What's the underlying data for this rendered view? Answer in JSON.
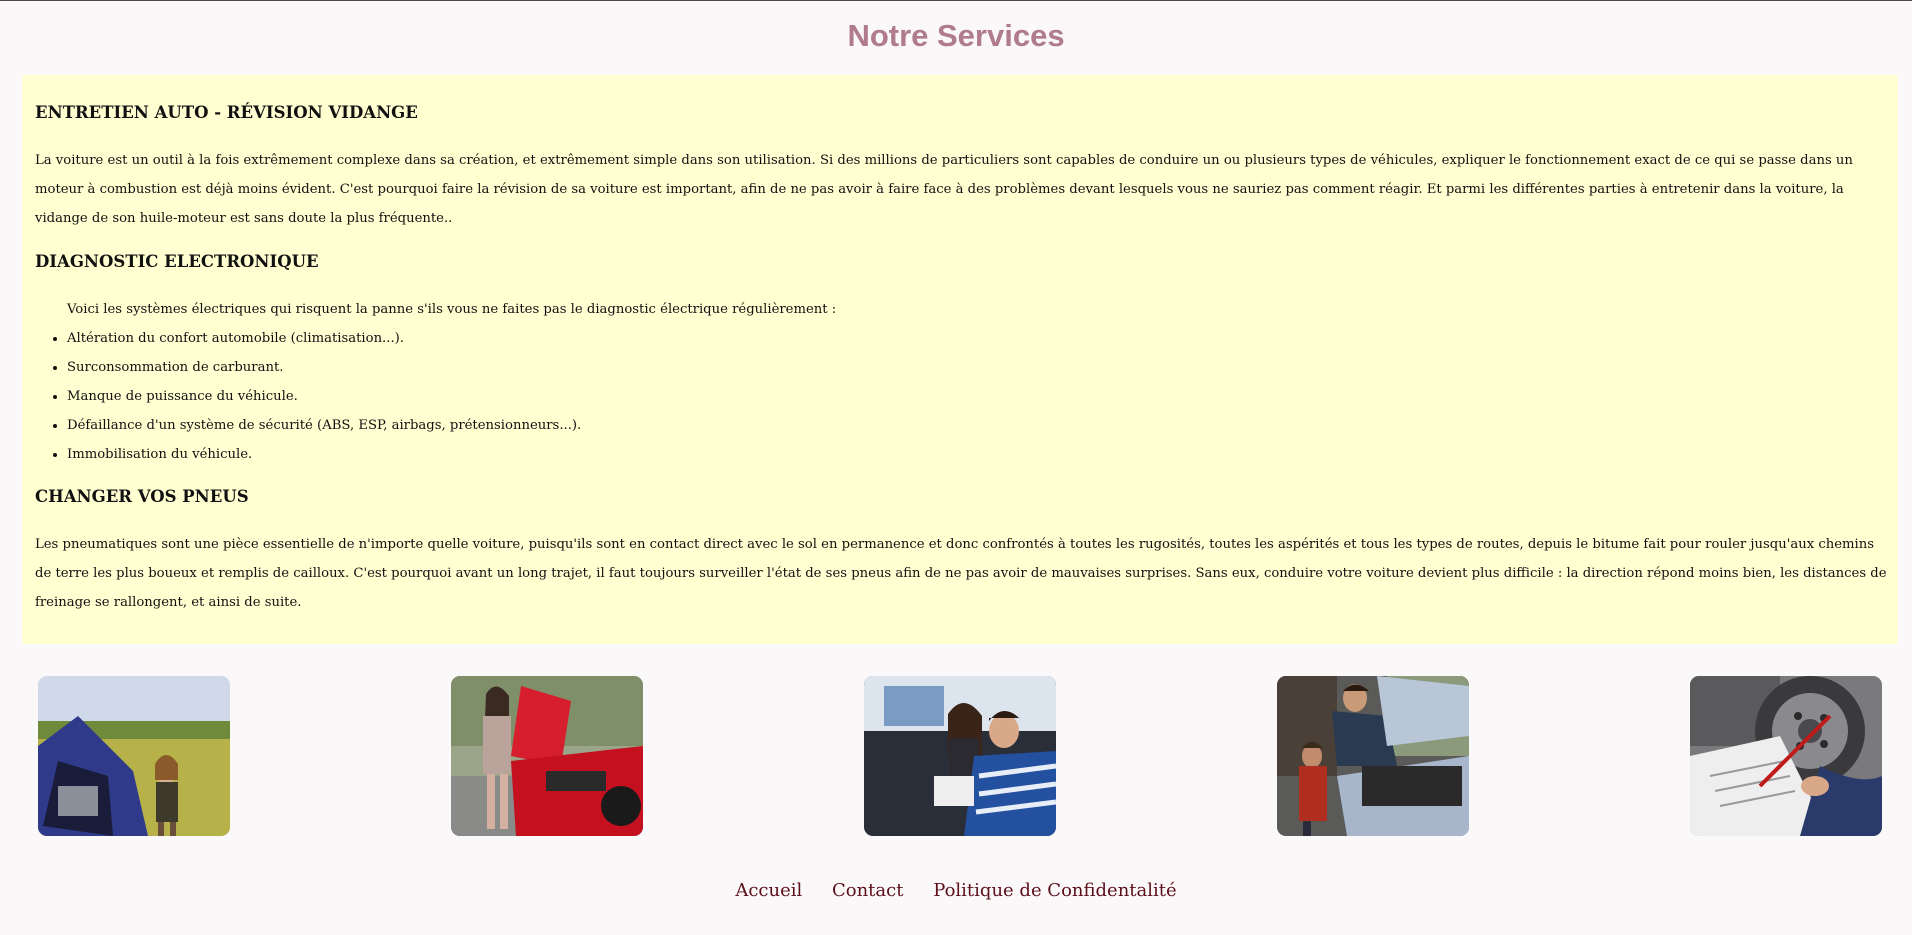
{
  "page": {
    "title": "Notre Services"
  },
  "services": [
    {
      "heading": "ENTRETIEN AUTO - RÉVISION VIDANGE",
      "text": "La voiture est un outil à la fois extrêmement complexe dans sa création, et extrêmement simple dans son utilisation. Si des millions de particuliers sont capables de conduire un ou plusieurs types de véhicules, expliquer le fonctionnement exact de ce qui se passe dans un moteur à combustion est déjà moins évident. C'est pourquoi faire la révision de sa voiture est important, afin de ne pas avoir à faire face à des problèmes devant lesquels vous ne sauriez pas comment réagir. Et parmi les différentes parties à entretenir dans la voiture, la vidange de son huile-moteur est sans doute la plus fréquente.."
    },
    {
      "heading": "DIAGNOSTIC ELECTRONIQUE",
      "intro": "Voici les systèmes électriques qui risquent la panne s'ils vous ne faites pas le diagnostic électrique régulièrement :",
      "items": [
        "Altération du confort automobile (climatisation...).",
        "Surconsommation de carburant.",
        "Manque de puissance du véhicule.",
        "Défaillance d'un système de sécurité (ABS, ESP, airbags, prétensionneurs...).",
        "Immobilisation du véhicule."
      ]
    },
    {
      "heading": "CHANGER VOS PNEUS",
      "text": "Les pneumatiques sont une pièce essentielle de n'importe quelle voiture, puisqu'ils sont en contact direct avec le sol en permanence et donc confrontés à toutes les rugosités, toutes les aspérités et tous les types de routes, depuis le bitume fait pour rouler jusqu'aux chemins de terre les plus boueux et remplis de cailloux. C'est pourquoi avant un long trajet, il faut toujours surveiller l'état de ses pneus afin de ne pas avoir de mauvaises surprises. Sans eux, conduire votre voiture devient plus difficile : la direction répond moins bien, les distances de freinage se rallongent, et ainsi de suite."
    }
  ],
  "footer": {
    "links": [
      "Accueil",
      "Contact",
      "Politique de Confidentalité"
    ]
  },
  "colors": {
    "title": "#b07b8b",
    "panel": "#ffffd2",
    "link": "#5c0f1a"
  }
}
